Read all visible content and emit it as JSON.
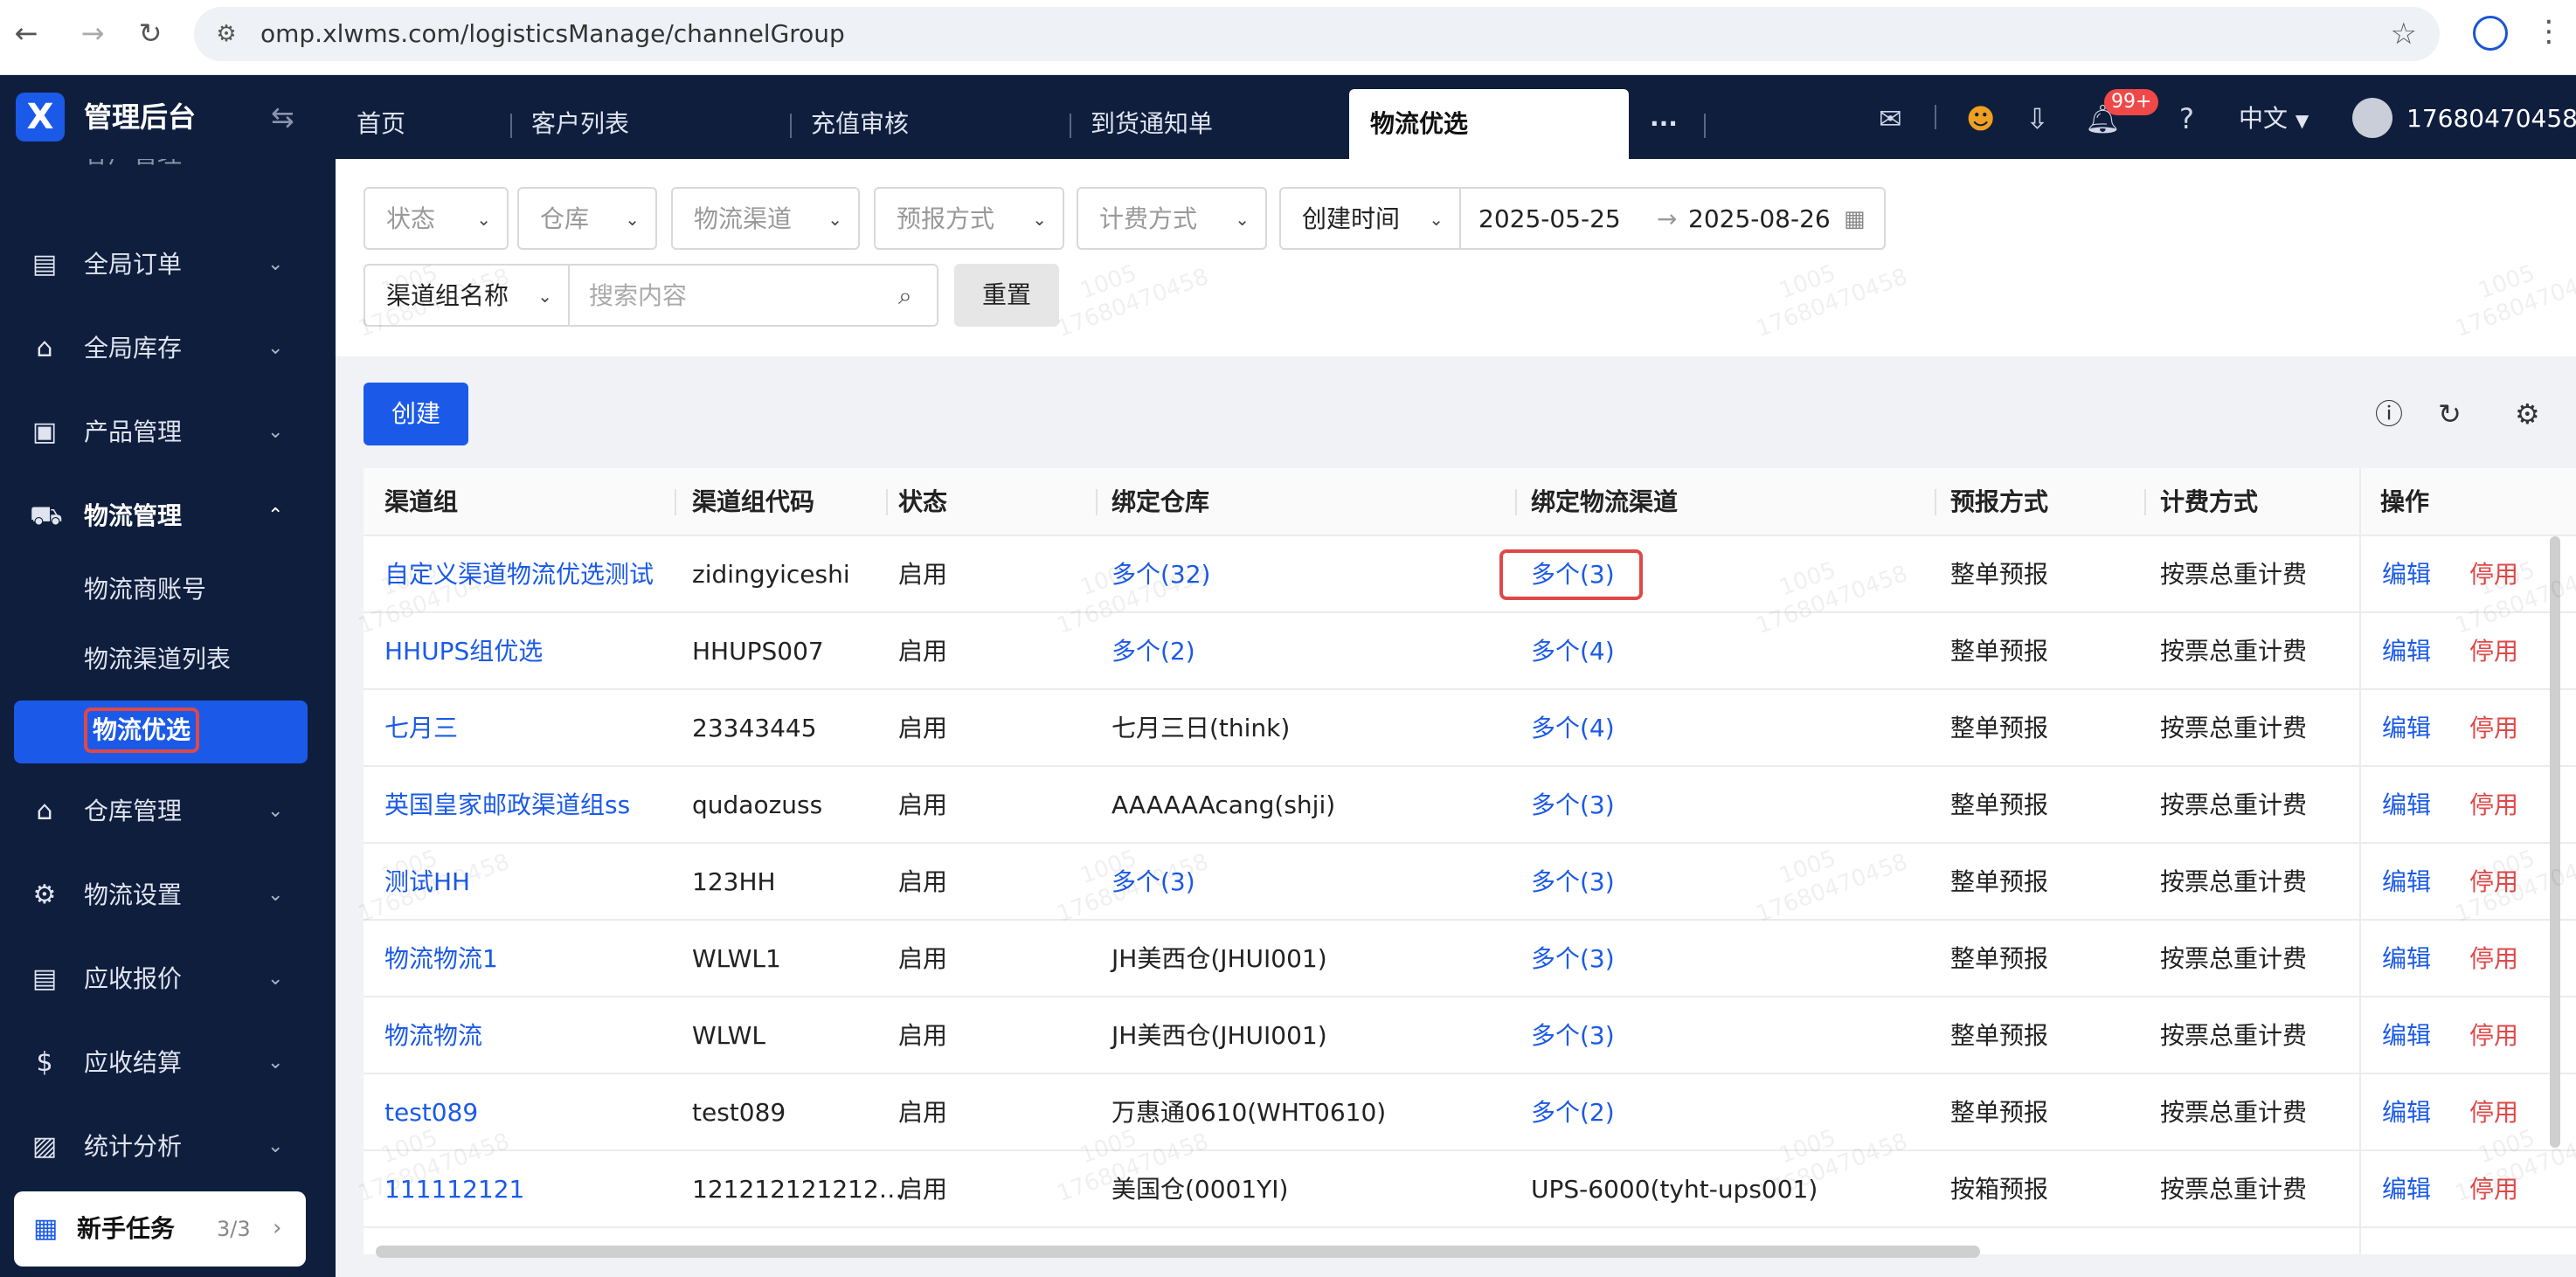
{
  "browser": {
    "url": "omp.xlwms.com/logisticsManage/channelGroup"
  },
  "header": {
    "brand": "管理后台",
    "tabs": [
      {
        "label": "首页"
      },
      {
        "label": "客户列表"
      },
      {
        "label": "充值审核"
      },
      {
        "label": "到货通知单"
      },
      {
        "label": "物流优选"
      }
    ],
    "more": "···",
    "notification_badge": "99+",
    "language": "中文",
    "user": "17680470458"
  },
  "sidebar": {
    "partial_top": "客户管理",
    "items": [
      {
        "label": "全局订单",
        "icon": "clipboard-icon"
      },
      {
        "label": "全局库存",
        "icon": "warehouse-icon"
      },
      {
        "label": "产品管理",
        "icon": "bag-icon"
      },
      {
        "label": "物流管理",
        "icon": "truck-icon"
      }
    ],
    "subitems": [
      {
        "label": "物流商账号"
      },
      {
        "label": "物流渠道列表"
      },
      {
        "label": "物流优选"
      }
    ],
    "items2": [
      {
        "label": "仓库管理",
        "icon": "house-icon"
      },
      {
        "label": "物流设置",
        "icon": "box-gear-icon"
      },
      {
        "label": "应收报价",
        "icon": "document-icon"
      },
      {
        "label": "应收结算",
        "icon": "dollar-icon"
      },
      {
        "label": "统计分析",
        "icon": "chart-icon"
      }
    ],
    "newbie": {
      "label": "新手任务",
      "count": "3/3"
    }
  },
  "filters": {
    "status": "状态",
    "warehouse": "仓库",
    "channel": "物流渠道",
    "forecast": "预报方式",
    "billing": "计费方式",
    "time_type": "创建时间",
    "date_start": "2025-05-25",
    "date_end": "2025-08-26",
    "search_field": "渠道组名称",
    "search_placeholder": "搜索内容",
    "reset": "重置"
  },
  "toolbar": {
    "create": "创建"
  },
  "table": {
    "headers": [
      "渠道组",
      "渠道组代码",
      "状态",
      "绑定仓库",
      "绑定物流渠道",
      "预报方式",
      "计费方式",
      "操作"
    ],
    "edit_label": "编辑",
    "disable_label": "停用",
    "rows": [
      {
        "group": "自定义渠道物流优选测试",
        "code": "zidingyiceshi",
        "status": "启用",
        "warehouse": "多个(32)",
        "channel": "多个(3)",
        "forecast": "整单预报",
        "billing": "按票总重计费"
      },
      {
        "group": "HHUPS组优选",
        "code": "HHUPS007",
        "status": "启用",
        "warehouse": "多个(2)",
        "channel": "多个(4)",
        "forecast": "整单预报",
        "billing": "按票总重计费"
      },
      {
        "group": "七月三",
        "code": "23343445",
        "status": "启用",
        "warehouse": "七月三日(think)",
        "channel": "多个(4)",
        "forecast": "整单预报",
        "billing": "按票总重计费"
      },
      {
        "group": "英国皇家邮政渠道组ss",
        "code": "qudaozuss",
        "status": "启用",
        "warehouse": "AAAAAAcang(shji)",
        "channel": "多个(3)",
        "forecast": "整单预报",
        "billing": "按票总重计费"
      },
      {
        "group": "测试HH",
        "code": "123HH",
        "status": "启用",
        "warehouse": "多个(3)",
        "channel": "多个(3)",
        "forecast": "整单预报",
        "billing": "按票总重计费"
      },
      {
        "group": "物流物流1",
        "code": "WLWL1",
        "status": "启用",
        "warehouse": "JH美西仓(JHUI001)",
        "channel": "多个(3)",
        "forecast": "整单预报",
        "billing": "按票总重计费"
      },
      {
        "group": "物流物流",
        "code": "WLWL",
        "status": "启用",
        "warehouse": "JH美西仓(JHUI001)",
        "channel": "多个(3)",
        "forecast": "整单预报",
        "billing": "按票总重计费"
      },
      {
        "group": "test089",
        "code": "test089",
        "status": "启用",
        "warehouse": "万惠通0610(WHT0610)",
        "channel": "多个(2)",
        "forecast": "整单预报",
        "billing": "按票总重计费"
      },
      {
        "group": "111112121",
        "code": "121212121212…",
        "status": "启用",
        "warehouse": "美国仓(0001YI)",
        "channel": "UPS-6000(tyht-ups001)",
        "forecast": "按箱预报",
        "billing": "按票总重计费"
      }
    ]
  },
  "watermark": {
    "line1": "1005",
    "line2": "17680470458"
  }
}
